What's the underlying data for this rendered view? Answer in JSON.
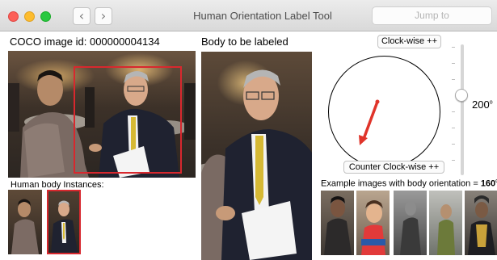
{
  "window": {
    "title": "Human Orientation Label Tool",
    "back_icon": "chevron-left-icon",
    "back_glyph": "‹",
    "forward_icon": "chevron-right-icon",
    "forward_glyph": "›",
    "jump_placeholder": "Jump to"
  },
  "left_panel": {
    "image_id_label": "COCO image id: 000000004134",
    "instances_label": "Human body Instances:",
    "thumbnails": 2,
    "selected_instance": 2,
    "bbox_color": "#d8282e"
  },
  "middle_panel": {
    "heading": "Body to be labeled"
  },
  "right_panel": {
    "clockwise_button": "Clock-wise ++",
    "counter_clockwise_button": "Counter Clock-wise ++",
    "angle_value": "200",
    "angle_unit": "o",
    "examples_prefix": "Example images with body orientation = ",
    "examples_angle": "160",
    "examples_unit": "o",
    "example_count": 5,
    "arrow_color": "#e0342a",
    "slider_level_fraction": 0.36
  }
}
